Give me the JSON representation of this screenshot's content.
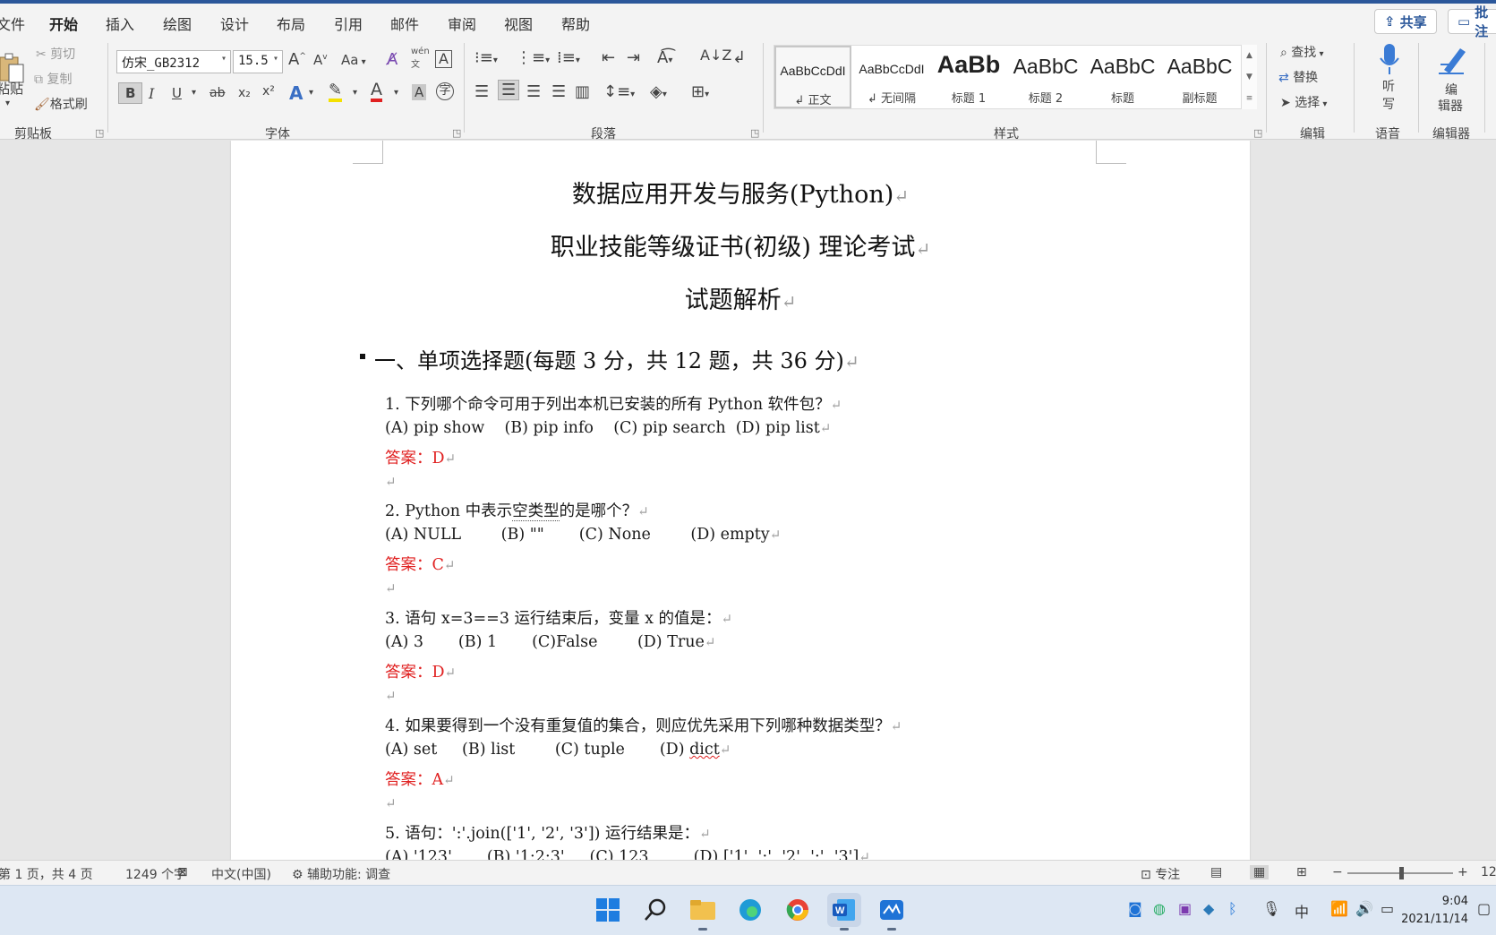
{
  "colors": {
    "accent": "#2b579a",
    "answer_red": "#e02020"
  },
  "tabs": [
    "文件",
    "开始",
    "插入",
    "绘图",
    "设计",
    "布局",
    "引用",
    "邮件",
    "审阅",
    "视图",
    "帮助"
  ],
  "active_tab": "开始",
  "header_buttons": {
    "share": "共享",
    "comments": "批注"
  },
  "clipboard": {
    "paste": "粘贴",
    "cut": "剪切",
    "copy": "复制",
    "format_painter": "格式刷",
    "group": "剪贴板"
  },
  "font": {
    "name": "仿宋_GB2312",
    "size": "15.5",
    "case": "Aa",
    "group": "字体",
    "bold": "B",
    "italic": "I",
    "underline": "U",
    "strike": "ab",
    "sub": "x₂",
    "sup": "x²",
    "grow": "A",
    "shrink": "A",
    "phonetic": "wén",
    "text_effect": "A",
    "highlight": "A",
    "font_color": "A",
    "char_shade": "A",
    "enclose": "字"
  },
  "paragraph": {
    "group": "段落"
  },
  "styles": {
    "group": "样式",
    "items": [
      {
        "sample": "AaBbCcDdI",
        "name": "正文"
      },
      {
        "sample": "AaBbCcDdI",
        "name": "无间隔"
      },
      {
        "sample": "AaBb",
        "name": "标题 1"
      },
      {
        "sample": "AaBbC",
        "name": "标题 2"
      },
      {
        "sample": "AaBbC",
        "name": "标题"
      },
      {
        "sample": "AaBbC",
        "name": "副标题"
      }
    ]
  },
  "editing": {
    "find": "查找",
    "replace": "替换",
    "select": "选择",
    "group": "编辑"
  },
  "voice": {
    "dictate_1": "听",
    "dictate_2": "写",
    "group": "语音"
  },
  "editor": {
    "label_1": "编",
    "label_2": "辑器",
    "group": "编辑器"
  },
  "document": {
    "title_1": "数据应用开发与服务(Python)",
    "title_2": "职业技能等级证书(初级) 理论考试",
    "title_3": "试题解析",
    "section_heading": "一、单项选择题(每题 3 分，共 12 题，共 36 分)",
    "q1": "1. 下列哪个命令可用于列出本机已安装的所有 Python 软件包？",
    "q1_options": "(A) pip show    (B) pip info    (C) pip search  (D) pip list",
    "q1_answer": "答案：D",
    "q2_prefix": "2. Python 中表示",
    "q2_marked": "空类型",
    "q2_suffix": "的是哪个？",
    "q2_options": "(A) NULL        (B) \"\"       (C) None        (D) empty",
    "q2_answer": "答案：C",
    "q3": "3. 语句 x=3==3 运行结束后，变量 x 的值是：",
    "q3_options": "(A) 3       (B) 1       (C)False        (D) True",
    "q3_answer": "答案：D",
    "q4": "4. 如果要得到一个没有重复值的集合，则应优先采用下列哪种数据类型？",
    "q4_options_main": "(A) set     (B) list        (C) tuple       (D) ",
    "q4_options_last": "dict",
    "q4_answer": "答案：A",
    "q5": "5. 语句：':'.join(['1', '2', '3']) 运行结果是：",
    "q5_options": "(A) '123'       (B) '1:2:3'     (C) 123         (D) ['1', ':', '2', ':', '3']",
    "para_mark": "↵"
  },
  "statusbar": {
    "page": "第 1 页，共 4 页",
    "words": "1249 个字",
    "language": "中文(中国)",
    "accessibility": "辅助功能: 调查",
    "focus": "专注",
    "zoom": "12"
  },
  "clock": {
    "time": "9:04",
    "date": "2021/11/14"
  },
  "tray": {
    "ime": "中"
  }
}
